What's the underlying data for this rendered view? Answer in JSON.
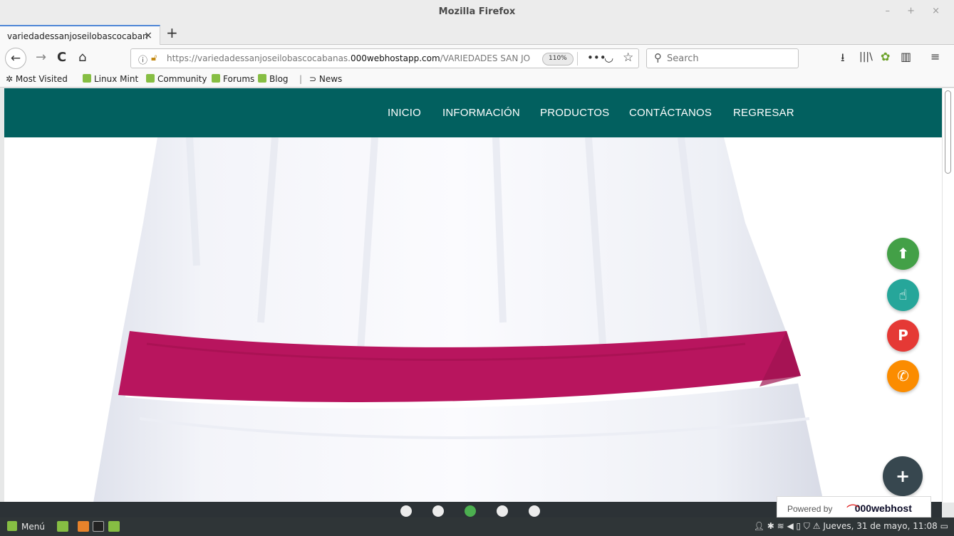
{
  "window": {
    "title": "Mozilla Firefox",
    "controls": "– + ×"
  },
  "tab": {
    "title": "variedadessanjoseilobascocaban",
    "close": "×",
    "new_tab": "+"
  },
  "navbar": {
    "back": "←",
    "forward": "→",
    "reload": "C",
    "home": "⌂",
    "url_prefix": "https://variedadessanjoseilobascocabanas.",
    "url_domain": "000webhostapp.com",
    "url_suffix": "/VARIEDADES SAN JOSÉ/\\",
    "zoom": "110%",
    "search_placeholder": "Search",
    "icons": [
      "download-icon",
      "library-icon",
      "extension-icon",
      "sidebar-icon",
      "menu-icon"
    ]
  },
  "bookmarks": [
    "Most Visited",
    "Linux Mint",
    "Community",
    "Forums",
    "Blog",
    "|",
    "News"
  ],
  "site": {
    "nav": [
      "INICIO",
      "INFORMACIÓN",
      "PRODUCTOS",
      "CONTÁCTANOS",
      "REGRESAR"
    ],
    "nav_bg": "#02605f",
    "fabs": [
      {
        "name": "upload-icon",
        "glyph": "⬆",
        "color": "#43a047"
      },
      {
        "name": "touch-icon",
        "glyph": "☝",
        "color": "#26a69a"
      },
      {
        "name": "parking-icon",
        "glyph": "P",
        "color": "#e53935"
      },
      {
        "name": "phone-icon",
        "glyph": "✆",
        "color": "#fb8c00"
      }
    ],
    "plus_fab": "+",
    "carousel": {
      "count": 5,
      "active_index": 2,
      "active_color": "#4caf50"
    },
    "powered_by": "Powered by",
    "powered_brand": "000webhost"
  },
  "taskbar": {
    "menu": "Menú",
    "clock": "Jueves, 31 de mayo, 11:08"
  }
}
